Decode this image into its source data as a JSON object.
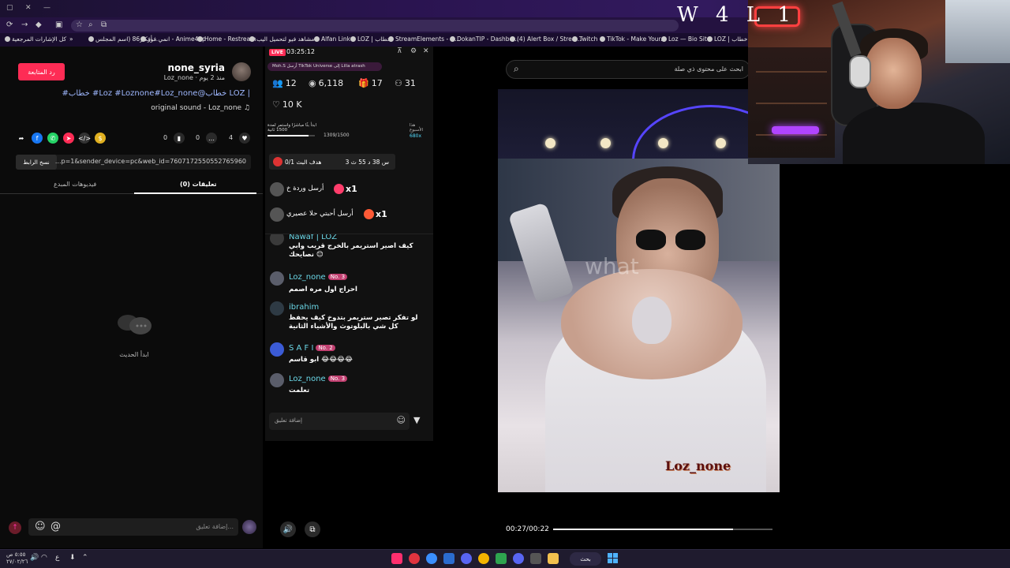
{
  "browser": {
    "bookmarks": [
      "كل الإشارات المرجعية",
      "أفكار86 (اسم المجلس...",
      "انمي فور - Anime4up",
      "Home - Restream",
      "مشاهد فيو لتحميل اليب",
      "Alfan Link",
      "LOZ | خطاب",
      "StreamElements - O...",
      "DokanTIP - Dashbo...",
      "(4) Alert Box / Strea...",
      "Twitch",
      "TikTok - Make Your...",
      "Loz — Bio Site",
      "LOZ | خطاب Soci"
    ]
  },
  "overlay": {
    "logo": "W 4 L 1"
  },
  "post": {
    "follow_label": "رد المتابعة",
    "username": "none_syria",
    "subline": "Loz_none · منذ 2 يوم",
    "description": "#خطاب #Loz #Loznone#Loz_none@خطاب LOZ |",
    "sound": "original sound - Loz_none ♫",
    "counts": {
      "likes": "4",
      "comments": "0",
      "saves": "0"
    },
    "copy_link_label": "نسخ الرابط",
    "link_text": "...p=1&sender_device=pc&web_id=7607172550552765960",
    "tabs": {
      "comments": "تعليقات (0)",
      "creator_videos": "فيديوهات المبدع"
    },
    "empty_text": "ابدأ الحديث",
    "comment_placeholder": "إضافة تعليق..."
  },
  "live": {
    "badge": "LIVE",
    "time": "03:25:12",
    "pinned": "Moh.S أرسل TikTok Universe إلى Lilla atrash",
    "stats": {
      "viewers": "12",
      "views": "6,118",
      "gifts": "17",
      "followers": "31",
      "likes": "10 K"
    },
    "goal_label": "ابدأ بثًا مباشرًا واستمر لمدة 1500 ثانية",
    "goal_progress": "1309/1500",
    "goal_progress_fraction": 0.873,
    "week_label": "هذا الأسبوع",
    "gift_count": "680x",
    "gift_goal": {
      "title": "هدف البث",
      "count": "0/1",
      "time": "3 س 38 د 55 ث"
    },
    "gifts": [
      {
        "text": "أرسل وردة خ",
        "multiplier": "x1",
        "color": "#ff3d6b"
      },
      {
        "text": "أرسل أحبتي حلا عصيري",
        "multiplier": "x1",
        "color": "#ff5a36"
      }
    ],
    "messages": [
      {
        "name": "Nawaf | LOZ",
        "badge": "",
        "text": "كيف اصير استريمر بالخرج قريب وابي نصايحك 😊",
        "avatar": "#3a3a3a"
      },
      {
        "name": "Loz_none",
        "badge": "No. 3",
        "text": "احراج اول مره اصمم",
        "avatar": "#5a5d6a"
      },
      {
        "name": "ibrahim",
        "badge": "",
        "text": "لو تفكر تصير ستريمر بتدوخ كيف يحفظ كل شي بالبلوتوث والأشياء الثانية",
        "avatar": "#2e3a44"
      },
      {
        "name": "S A F I",
        "badge": "No. 2",
        "text": "ابو قاسم 😂😂😂😂",
        "avatar": "#3b5bd6"
      },
      {
        "name": "Loz_none",
        "badge": "No. 3",
        "text": "تعلمت",
        "avatar": "#5a5d6a"
      }
    ],
    "comment_placeholder": "إضافة تعليق"
  },
  "player": {
    "search_placeholder": "ابحث على محتوى ذي صلة",
    "watermark": "Loz_none",
    "ghost_text": "what",
    "time": "00:27/00:22",
    "progress_fraction": 0.82
  },
  "taskbar": {
    "clock": "٥:٥٥ ص",
    "date": "٢٧/٠٢/٢٦",
    "lang": "ع",
    "search_label": "بحث"
  },
  "colors": {
    "accent": "#fe2c55",
    "link_blue": "#9fb8ff",
    "username_cyan": "#6bd8e8"
  }
}
